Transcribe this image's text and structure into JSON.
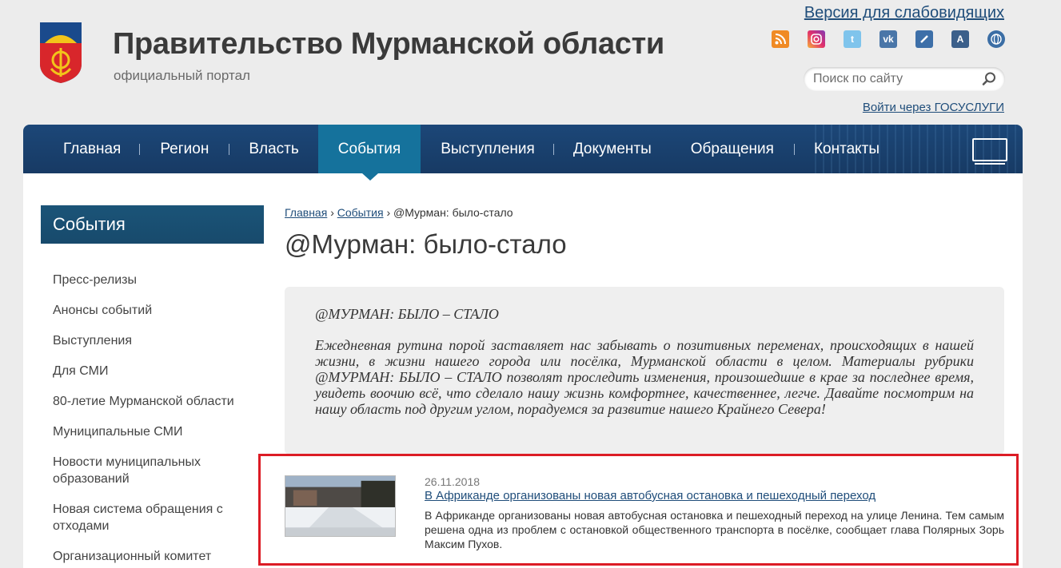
{
  "header": {
    "title": "Правительство Мурманской области",
    "subtitle": "официальный портал",
    "vision_link": "Версия для слабовидящих",
    "search_placeholder": "Поиск по сайту",
    "gosuslugi_link": "Войти через ГОСУСЛУГИ",
    "socials": [
      {
        "icon": "rss-icon",
        "color": "#f08a24"
      },
      {
        "icon": "instagram-icon",
        "color": "#c13584"
      },
      {
        "icon": "twitter-icon",
        "color": "#3f9fd6"
      },
      {
        "icon": "vk-icon",
        "color": "#4a76a8"
      },
      {
        "icon": "feather-icon",
        "color": "#3d6fa8"
      },
      {
        "icon": "font-a-icon",
        "color": "#3b5f8a"
      },
      {
        "icon": "globe-icon",
        "color": "#3b6ea5"
      }
    ]
  },
  "nav": {
    "items": [
      "Главная",
      "Регион",
      "Власть",
      "События",
      "Выступления",
      "Документы",
      "Обращения",
      "Контакты"
    ],
    "active": "События"
  },
  "sidebar": {
    "heading": "События",
    "items": [
      "Пресс-релизы",
      "Анонсы событий",
      "Выступления",
      "Для СМИ",
      "80-летие Мурманской области",
      "Муниципальные СМИ",
      "Новости муниципальных образований",
      "Новая система обращения с отходами",
      "Организационный комитет"
    ]
  },
  "breadcrumb": {
    "home": "Главная",
    "section": "События",
    "current": "@Мурман: было-стало"
  },
  "page": {
    "title": "@Мурман: было-стало"
  },
  "intro": {
    "heading": "@МУРМАН: БЫЛО – СТАЛО",
    "text": "Ежедневная рутина порой заставляет нас забывать о позитивных переменах, происходящих в нашей жизни, в жизни нашего города или посёлка, Мурманской области в целом. Материалы рубрики @МУРМАН: БЫЛО – СТАЛО позволят проследить изменения, произошедшие в крае за последнее время, увидеть воочию всё, что сделало нашу жизнь комфортнее, качественнее, легче. Давайте посмотрим на нашу область под другим углом, порадуемся за развитие нашего Крайнего Севера!"
  },
  "news": {
    "date": "26.11.2018",
    "title": "В Африканде организованы новая автобусная остановка и пешеходный переход",
    "text": "В Африканде организованы новая автобусная остановка и пешеходный переход на улице Ленина. Тем самым решена одна из проблем с остановкой общественного транспорта в посёлке, сообщает глава Полярных Зорь Максим Пухов."
  },
  "colors": {
    "nav_bg": "#1c4778",
    "nav_active": "#15729c",
    "link": "#1f4d7a",
    "highlight_border": "#dc1c25"
  }
}
